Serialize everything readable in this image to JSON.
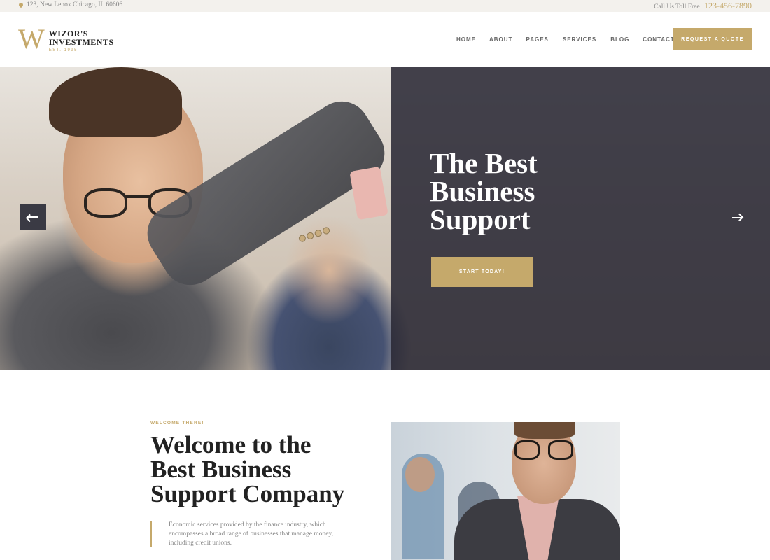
{
  "topbar": {
    "address": "123, New Lenox Chicago, IL 60606",
    "phone_label": "Call Us Toll Free",
    "phone_number": "123-456-7890"
  },
  "brand": {
    "logo_mark": "W",
    "name_line1": "WIZOR'S",
    "name_line2": "INVESTMENTS",
    "established": "EST. 1995"
  },
  "nav": {
    "items": [
      "HOME",
      "ABOUT",
      "PAGES",
      "SERVICES",
      "BLOG",
      "CONTACTS"
    ],
    "cta_label": "REQUEST A QUOTE"
  },
  "hero": {
    "title_line1": "The Best",
    "title_line2": "Business",
    "title_line3": "Support",
    "cta_label": "START TODAY!",
    "prev_icon": "arrow-left-icon",
    "next_icon": "arrow-right-icon"
  },
  "welcome": {
    "eyebrow": "WELCOME THERE!",
    "title_line1": "Welcome to the",
    "title_line2": "Best Business",
    "title_line3": "Support Company",
    "body": "Economic services provided by the finance industry, which encompasses a broad range of businesses that manage money, including credit unions."
  },
  "colors": {
    "accent": "#c5a96b",
    "overlay": "#262532",
    "topbar_bg": "#f3f1ed"
  }
}
